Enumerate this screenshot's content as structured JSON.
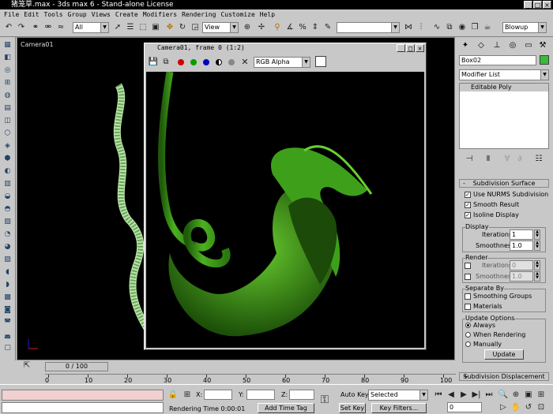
{
  "window": {
    "title": "猪笼草.max - 3ds max 6 - Stand-alone License"
  },
  "menu": [
    "File",
    "Edit",
    "Tools",
    "Group",
    "Views",
    "Create",
    "Modifiers",
    "Rendering",
    "Customize",
    "Help"
  ],
  "toolbar": {
    "selection_filter": "All",
    "ref_coord": "View",
    "named_sel": "",
    "render_type": "Blowup"
  },
  "viewport": {
    "label": "Camera01"
  },
  "frame_window": {
    "title": "Camera01, frame 0 (1:2)",
    "channel": "RGB Alpha"
  },
  "command_panel": {
    "object_name": "Box02",
    "object_color": "#3db83d",
    "modifier_list_label": "Modifier List",
    "stack_item": "Editable Poly",
    "rollout_subdiv": "Subdivision Surface",
    "use_nurms": "Use NURMS Subdivision",
    "smooth_result": "Smooth Result",
    "isoline_display": "Isoline Display",
    "display_group": "Display",
    "iterations_label": "Iterations:",
    "iterations_value": "1",
    "smoothness_label": "Smoothness:",
    "smoothness_value": "1.0",
    "render_group": "Render",
    "render_iterations_value": "0",
    "render_smoothness_value": "1.0",
    "separate_group": "Separate By",
    "smoothing_groups": "Smoothing Groups",
    "materials": "Materials",
    "update_group": "Update Options",
    "always": "Always",
    "when_rendering": "When Rendering",
    "manually": "Manually",
    "update_button": "Update",
    "rollout_displacement": "Subdivision Displacement"
  },
  "timeline": {
    "slider": "0 / 100",
    "ticks": [
      "0",
      "10",
      "20",
      "30",
      "40",
      "50",
      "60",
      "70",
      "80",
      "90",
      "100"
    ]
  },
  "status": {
    "x_label": "X:",
    "y_label": "Y:",
    "z_label": "Z:",
    "render_time": "Rendering Time 0:00:01",
    "add_time_tag": "Add Time Tag",
    "auto_key": "Auto Key",
    "selected": "Selected",
    "set_key": "Set Key",
    "key_filters": "Key Filters...",
    "frame": "0"
  }
}
